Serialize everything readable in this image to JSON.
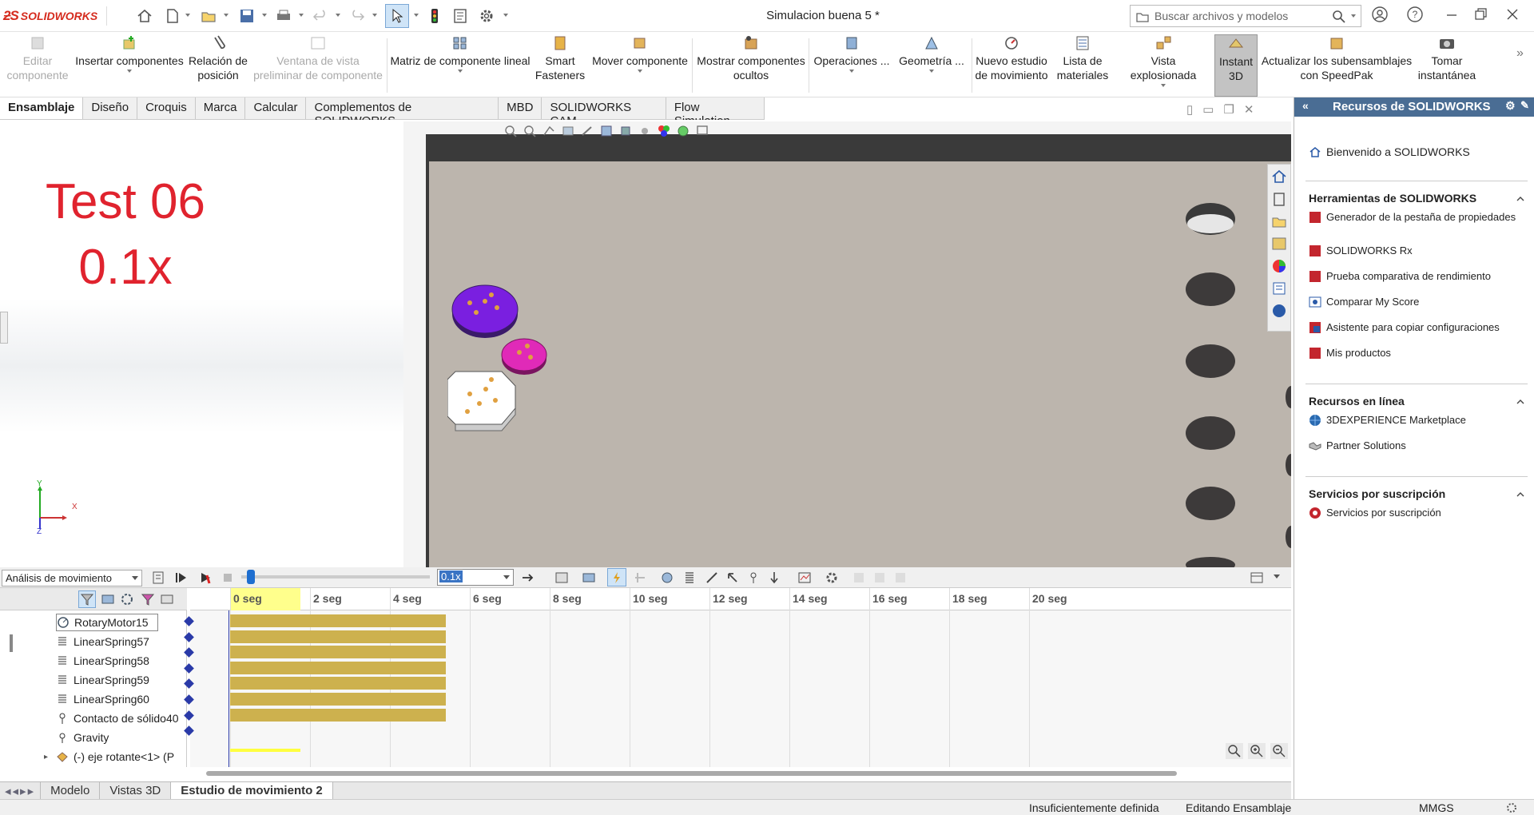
{
  "app": {
    "brand": "SOLIDWORKS",
    "doc_title": "Simulacion buena 5 *",
    "search_placeholder": "Buscar archivos y modelos"
  },
  "ribbon": {
    "items": [
      {
        "label": "Editar componente",
        "disabled": true,
        "icon": "edit-component-icon"
      },
      {
        "label": "Insertar componentes",
        "disabled": false,
        "icon": "insert-components-icon"
      },
      {
        "label": "Relación de posición",
        "disabled": false,
        "icon": "mate-icon"
      },
      {
        "label": "Ventana de vista preliminar de componente",
        "disabled": true,
        "icon": "preview-window-icon"
      },
      {
        "label": "Matriz de componente lineal",
        "disabled": false,
        "icon": "linear-pattern-icon"
      },
      {
        "label": "Smart Fasteners",
        "disabled": false,
        "icon": "smart-fasteners-icon"
      },
      {
        "label": "Mover componente",
        "disabled": false,
        "icon": "move-component-icon"
      },
      {
        "label": "Mostrar componentes ocultos",
        "disabled": false,
        "icon": "show-hidden-icon"
      },
      {
        "label": "Operaciones ...",
        "disabled": false,
        "icon": "features-icon"
      },
      {
        "label": "Geometría ...",
        "disabled": false,
        "icon": "geometry-icon"
      },
      {
        "label": "Nuevo estudio de movimiento",
        "disabled": false,
        "icon": "motion-study-icon"
      },
      {
        "label": "Lista de materiales",
        "disabled": false,
        "icon": "bom-icon"
      },
      {
        "label": "Vista explosionada",
        "disabled": false,
        "icon": "exploded-view-icon"
      },
      {
        "label": "Instant 3D",
        "disabled": false,
        "icon": "instant3d-icon"
      },
      {
        "label": "Actualizar los subensamblajes con SpeedPak",
        "disabled": false,
        "icon": "speedpak-icon"
      },
      {
        "label": "Tomar instantánea",
        "disabled": false,
        "icon": "snapshot-icon"
      }
    ]
  },
  "tabs": [
    "Ensamblaje",
    "Diseño",
    "Croquis",
    "Marca",
    "Calcular",
    "Complementos de SOLIDWORKS",
    "MBD",
    "SOLIDWORKS CAM",
    "Flow Simulation"
  ],
  "viewport": {
    "title_line1": "Test 06",
    "title_line2": "0.1x",
    "axis_x": "X",
    "axis_y": "Y",
    "axis_z": "Z"
  },
  "motion": {
    "analysis_type": "Análisis de movimiento",
    "speed": "0.1x",
    "playback_progress": 0.05,
    "time_labels": [
      "0 seg",
      "2 seg",
      "4 seg",
      "6 seg",
      "8 seg",
      "10 seg",
      "12 seg",
      "14 seg",
      "16 seg",
      "18 seg",
      "20 seg"
    ],
    "tree": [
      {
        "label": "RotaryMotor15",
        "icon": "rotary-motor-icon"
      },
      {
        "label": "LinearSpring57",
        "icon": "spring-icon"
      },
      {
        "label": "LinearSpring58",
        "icon": "spring-icon"
      },
      {
        "label": "LinearSpring59",
        "icon": "spring-icon"
      },
      {
        "label": "LinearSpring60",
        "icon": "spring-icon"
      },
      {
        "label": "Contacto de sólido40",
        "icon": "contact-icon"
      },
      {
        "label": "Gravity",
        "icon": "gravity-icon"
      },
      {
        "label": "(-) eje rotante<1> (P",
        "icon": "part-icon"
      }
    ],
    "bar_end_seconds": 5.4
  },
  "bottom_tabs": [
    "Modelo",
    "Vistas 3D",
    "Estudio de movimiento 2"
  ],
  "status": {
    "definition": "Insuficientemente definida",
    "mode": "Editando Ensamblaje",
    "units": "MMGS"
  },
  "resources": {
    "title": "Recursos de SOLIDWORKS",
    "welcome": "Bienvenido a SOLIDWORKS",
    "sections": [
      {
        "title": "Herramientas de SOLIDWORKS",
        "items": [
          "Generador de la pestaña de propiedades",
          "SOLIDWORKS Rx",
          "Prueba comparativa de rendimiento",
          "Comparar My Score",
          "Asistente para copiar configuraciones",
          "Mis productos"
        ]
      },
      {
        "title": "Recursos en línea",
        "items": [
          "3DEXPERIENCE Marketplace",
          "Partner Solutions"
        ]
      },
      {
        "title": "Servicios por suscripción",
        "items": [
          "Servicios por suscripción"
        ]
      }
    ]
  },
  "colors": {
    "accent_red": "#e0232e",
    "timeline_bar": "#cdb14e",
    "panel_header": "#4a6d94",
    "purple_disc": "#7a1fe0",
    "magenta_disc": "#e02ab8"
  }
}
